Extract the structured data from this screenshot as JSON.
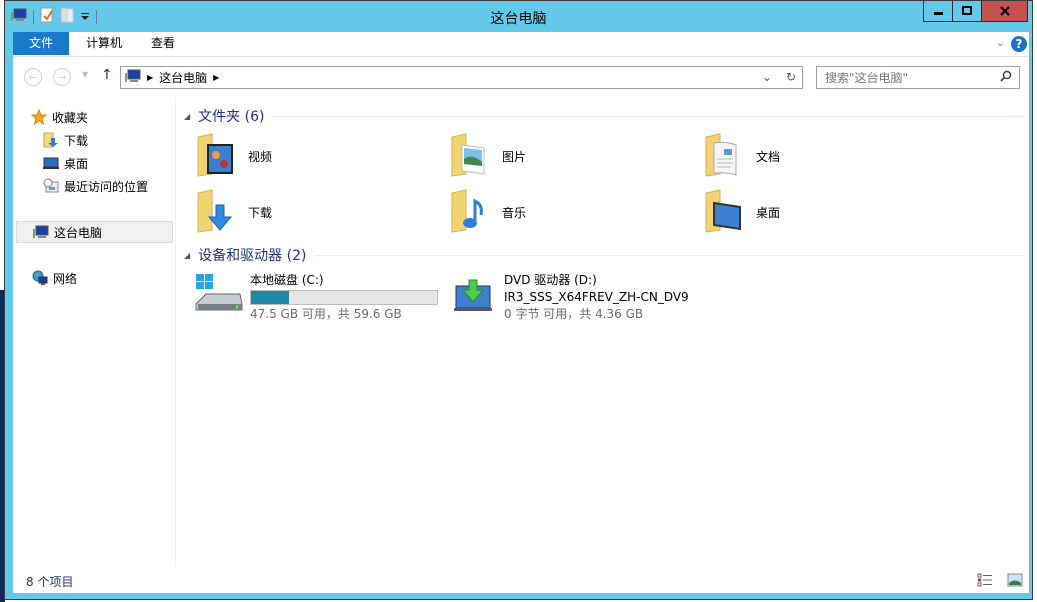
{
  "window": {
    "title": "这台电脑",
    "controls": {
      "minimize": "minimize",
      "maximize": "maximize",
      "close": "close"
    }
  },
  "ribbon": {
    "tabs": [
      {
        "label": "文件",
        "active": true
      },
      {
        "label": "计算机",
        "active": false
      },
      {
        "label": "查看",
        "active": false
      }
    ],
    "help_label": "?"
  },
  "navigation": {
    "breadcrumb": [
      "这台电脑"
    ],
    "search_placeholder": "搜索\"这台电脑\""
  },
  "sidebar": {
    "favorites": {
      "label": "收藏夹",
      "items": [
        {
          "label": "下载",
          "icon": "download-folder-icon"
        },
        {
          "label": "桌面",
          "icon": "desktop-icon"
        },
        {
          "label": "最近访问的位置",
          "icon": "recent-places-icon"
        }
      ]
    },
    "this_pc": {
      "label": "这台电脑",
      "selected": true
    },
    "network": {
      "label": "网络"
    }
  },
  "content": {
    "folders_header": "文件夹 (6)",
    "folders": [
      {
        "label": "视频",
        "icon": "videos-folder-icon"
      },
      {
        "label": "图片",
        "icon": "pictures-folder-icon"
      },
      {
        "label": "文档",
        "icon": "documents-folder-icon"
      },
      {
        "label": "下载",
        "icon": "downloads-folder-icon"
      },
      {
        "label": "音乐",
        "icon": "music-folder-icon"
      },
      {
        "label": "桌面",
        "icon": "desktop-folder-icon"
      }
    ],
    "devices_header": "设备和驱动器 (2)",
    "drives": [
      {
        "name": "本地磁盘 (C:)",
        "free_text": "47.5 GB 可用，共 59.6 GB",
        "used_fraction": 0.203,
        "bar_color": "#1e89a7"
      },
      {
        "name": "DVD 驱动器 (D:)",
        "volume": "IR3_SSS_X64FREV_ZH-CN_DV9",
        "free_text": "0 字节 可用，共 4.36 GB"
      }
    ]
  },
  "status": {
    "item_count": "8 个项目"
  }
}
